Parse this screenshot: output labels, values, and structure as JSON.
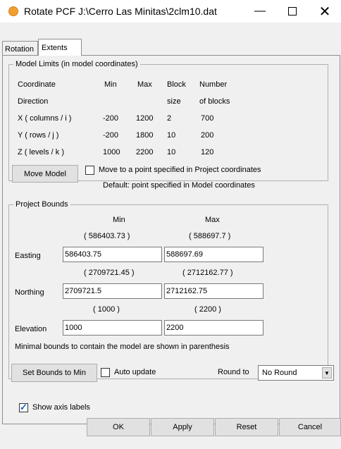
{
  "window": {
    "title": "Rotate PCF J:\\Cerro Las Minitas\\2clm10.dat",
    "minimize_glyph": "—",
    "close_glyph": "✕"
  },
  "tabs": [
    {
      "label": "Rotation",
      "active": false
    },
    {
      "label": "Extents",
      "active": true
    }
  ],
  "model_limits": {
    "legend": "Model Limits (in model coordinates)",
    "headers": {
      "coord1": "Coordinate",
      "coord2": "Direction",
      "min": "Min",
      "max": "Max",
      "block1": "Block",
      "block2": "size",
      "number1": "Number",
      "number2": "of blocks"
    },
    "rows": [
      {
        "direction": "X ( columns / i )",
        "min": "-200",
        "max": "1200",
        "block_size": "2",
        "num_blocks": "700"
      },
      {
        "direction": "Y ( rows / j )",
        "min": "-200",
        "max": "1800",
        "block_size": "10",
        "num_blocks": "200"
      },
      {
        "direction": "Z (  levels / k )",
        "min": "1000",
        "max": "2200",
        "block_size": "10",
        "num_blocks": "120"
      }
    ]
  },
  "move_model": {
    "button_label": "Move Model",
    "checkbox_label": "Move to a point specified in Project coordinates",
    "checked": false,
    "default_note": "Default: point specified in Model coordinates"
  },
  "project_bounds": {
    "legend": "Project Bounds",
    "min_header": "Min",
    "max_header": "Max",
    "easting": {
      "label": "Easting",
      "min_hint": "( 586403.73 )",
      "max_hint": "( 588697.7 )",
      "min_value": "586403.75",
      "max_value": "588697.69"
    },
    "northing": {
      "label": "Northing",
      "min_hint": "( 2709721.45 )",
      "max_hint": "( 2712162.77 )",
      "min_value": "2709721.5",
      "max_value": "2712162.75"
    },
    "elevation": {
      "label": "Elevation",
      "min_hint": "( 1000 )",
      "max_hint": "( 2200 )",
      "min_value": "1000",
      "max_value": "2200"
    },
    "note": "Minimal bounds to contain the model are shown in parenthesis"
  },
  "bounds_controls": {
    "set_bounds_label": "Set Bounds to Min",
    "auto_update_label": "Auto update",
    "auto_update_checked": false,
    "round_to_label": "Round to",
    "round_to_value": "No Round"
  },
  "footer": {
    "show_axis_labels": "Show axis labels",
    "show_axis_checked": true,
    "ok": "OK",
    "apply": "Apply",
    "reset": "Reset",
    "cancel": "Cancel"
  }
}
